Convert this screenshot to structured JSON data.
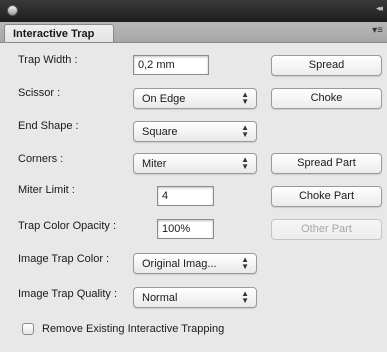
{
  "panel": {
    "tab_title": "Interactive Trap",
    "tab_close": "×",
    "menu_glyph": "▾≡",
    "collapse_glyph": "◂◂"
  },
  "fields": {
    "trap_width": {
      "label": "Trap Width :",
      "value": "0,2 mm"
    },
    "scissor": {
      "label": "Scissor :",
      "value": "On Edge"
    },
    "end_shape": {
      "label": "End Shape :",
      "value": "Square"
    },
    "corners": {
      "label": "Corners :",
      "value": "Miter"
    },
    "miter_limit": {
      "label": "Miter Limit :",
      "value": "4"
    },
    "trap_color_opacity": {
      "label": "Trap Color Opacity :",
      "value": "100%"
    },
    "image_trap_color": {
      "label": "Image Trap Color :",
      "value": "Original Imag..."
    },
    "image_trap_quality": {
      "label": "Image Trap Quality :",
      "value": "Normal"
    }
  },
  "buttons": {
    "spread": "Spread",
    "choke": "Choke",
    "spread_part": "Spread Part",
    "choke_part": "Choke Part",
    "other_part": "Other Part"
  },
  "checkbox": {
    "label": "Remove Existing Interactive Trapping",
    "checked": false
  },
  "select_arrows": "▴\n▾"
}
